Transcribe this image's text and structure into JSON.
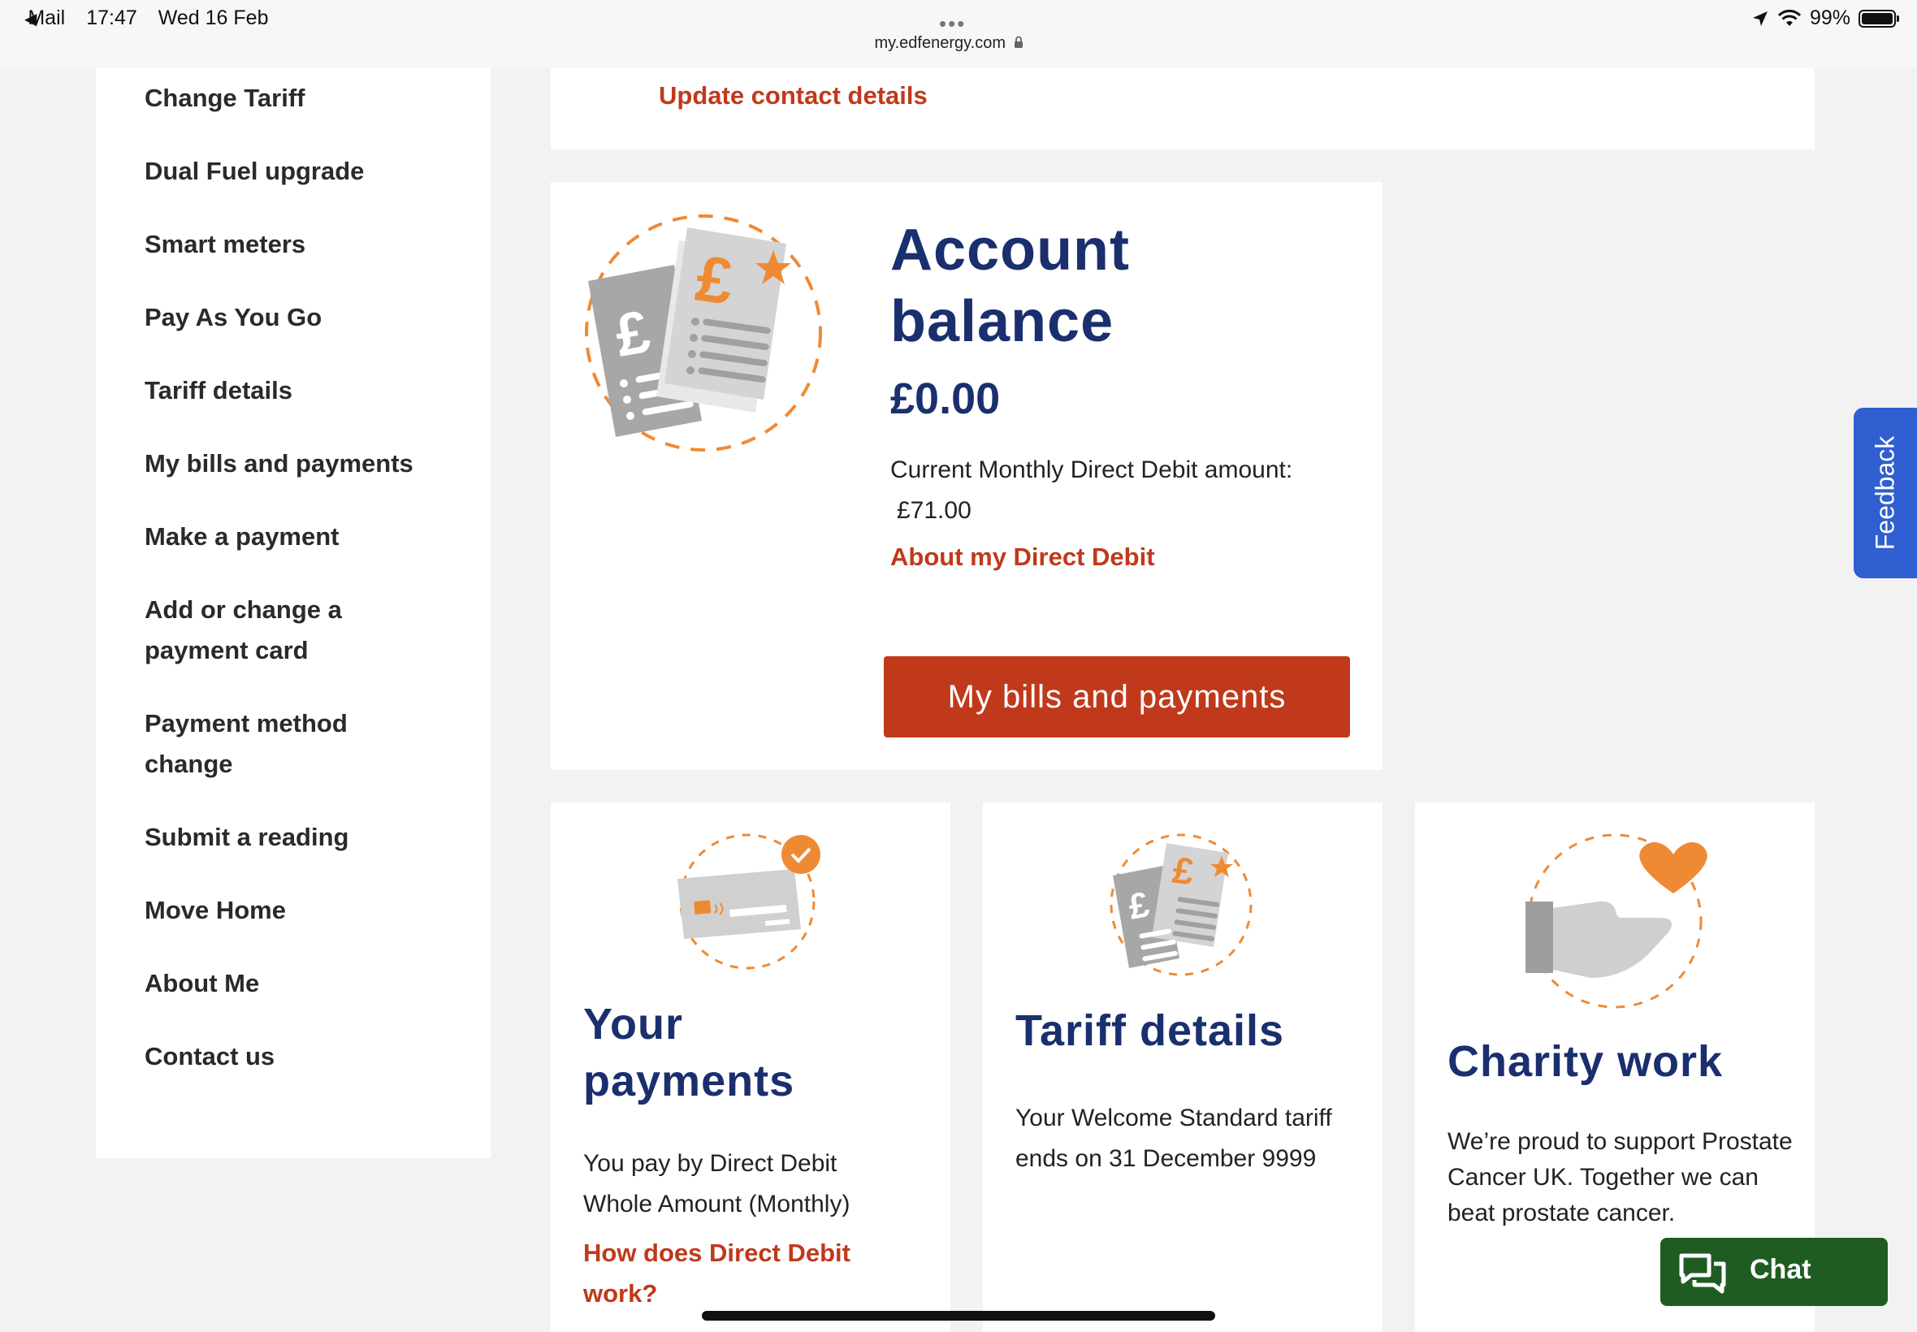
{
  "status_bar": {
    "back_app": "Mail",
    "time": "17:47",
    "date": "Wed 16 Feb",
    "url": "my.edfenergy.com",
    "battery": "99%"
  },
  "sidebar": {
    "items": [
      {
        "label": "Change Tariff"
      },
      {
        "label": "Dual Fuel upgrade"
      },
      {
        "label": "Smart meters"
      },
      {
        "label": "Pay As You Go"
      },
      {
        "label": "Tariff details"
      },
      {
        "label": "My bills and payments"
      },
      {
        "label": "Make a payment"
      },
      {
        "label": "Add or change a payment card"
      },
      {
        "label": "Payment method change"
      },
      {
        "label": "Submit a reading"
      },
      {
        "label": "Move Home"
      },
      {
        "label": "About Me"
      },
      {
        "label": "Contact us"
      }
    ]
  },
  "top_card": {
    "link": "Update contact details"
  },
  "balance": {
    "title": "Account balance",
    "amount": "£0.00",
    "dd_label": "Current Monthly Direct Debit amount:",
    "dd_amount": "£71.00",
    "link": "About my Direct Debit",
    "button": "My bills and payments"
  },
  "payments_card": {
    "title": "Your payments",
    "text": "You pay by Direct Debit Whole Amount (Monthly)",
    "link": "How does Direct Debit work?"
  },
  "tariff_card": {
    "title": "Tariff details",
    "text": "Your Welcome Standard tariff ends on 31 December 9999"
  },
  "charity_card": {
    "title": "Charity work",
    "text": "We’re proud to support Prostate Cancer UK. Together we can beat prostate cancer."
  },
  "feedback": {
    "label": "Feedback"
  },
  "chat": {
    "label": "Chat"
  },
  "colors": {
    "accent": "#c0391b",
    "navy": "#1a2f6e",
    "orange": "#ef8a34",
    "feedback_blue": "#2f5fd0",
    "chat_green": "#1f5c22"
  }
}
